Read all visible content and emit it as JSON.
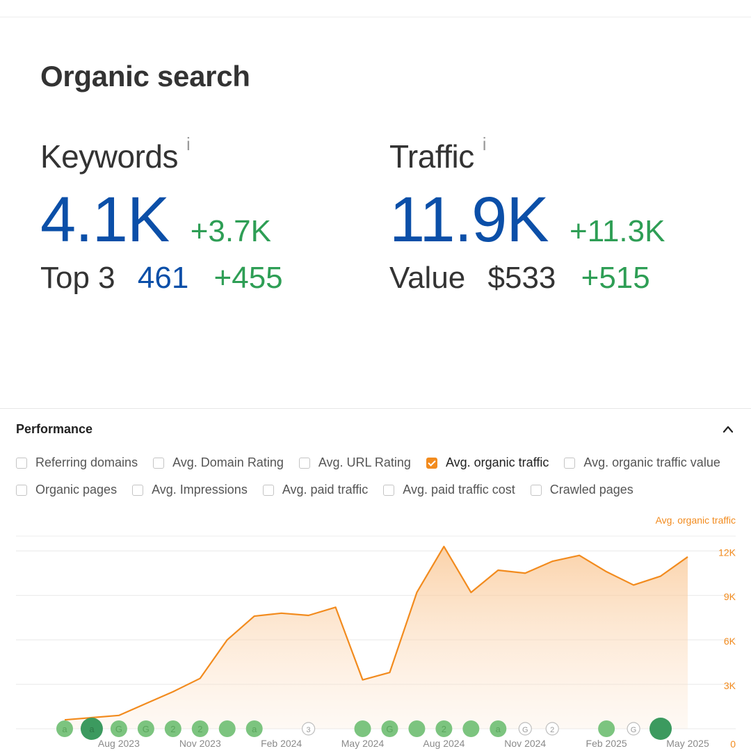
{
  "organic": {
    "title": "Organic search",
    "keywords": {
      "label": "Keywords",
      "info": "i",
      "value": "4.1K",
      "delta": "+3.7K",
      "sub_label": "Top 3",
      "sub_value": "461",
      "sub_delta": "+455"
    },
    "traffic": {
      "label": "Traffic",
      "info": "i",
      "value": "11.9K",
      "delta": "+11.3K",
      "sub_label": "Value",
      "sub_value": "$533",
      "sub_delta": "+515"
    }
  },
  "performance": {
    "title": "Performance",
    "collapse_icon": "chevron-up-icon",
    "checkboxes": [
      {
        "label": "Referring domains",
        "checked": false
      },
      {
        "label": "Avg. Domain Rating",
        "checked": false
      },
      {
        "label": "Avg. URL Rating",
        "checked": false
      },
      {
        "label": "Avg. organic traffic",
        "checked": true
      },
      {
        "label": "Avg. organic traffic value",
        "checked": false
      },
      {
        "label": "Organic pages",
        "checked": false
      },
      {
        "label": "Avg. Impressions",
        "checked": false
      },
      {
        "label": "Avg. paid traffic",
        "checked": false
      },
      {
        "label": "Avg. paid traffic cost",
        "checked": false
      },
      {
        "label": "Crawled pages",
        "checked": false
      }
    ]
  },
  "colors": {
    "accent": "#f28b1e",
    "value_blue": "#0b4fa8",
    "delta_green": "#2e9e55",
    "marker_green": "#7cc47f",
    "marker_dark": "#3c9a5f"
  },
  "chart_data": {
    "type": "area",
    "series": [
      {
        "name": "Avg. organic traffic",
        "color": "#f28b1e"
      }
    ],
    "ylim": [
      0,
      13000
    ],
    "yticks": [
      {
        "v": 0,
        "label": "0"
      },
      {
        "v": 3000,
        "label": "3K"
      },
      {
        "v": 6000,
        "label": "6K"
      },
      {
        "v": 9000,
        "label": "9K"
      },
      {
        "v": 12000,
        "label": "12K"
      }
    ],
    "xlim": [
      0,
      24
    ],
    "xticks": [
      {
        "x": 2,
        "label": "Aug 2023"
      },
      {
        "x": 5,
        "label": "Nov 2023"
      },
      {
        "x": 8,
        "label": "Feb 2024"
      },
      {
        "x": 11,
        "label": "May 2024"
      },
      {
        "x": 14,
        "label": "Aug 2024"
      },
      {
        "x": 17,
        "label": "Nov 2024"
      },
      {
        "x": 20,
        "label": "Feb 2025"
      },
      {
        "x": 23,
        "label": "May 2025"
      }
    ],
    "points": [
      [
        0,
        600
      ],
      [
        1,
        750
      ],
      [
        2,
        900
      ],
      [
        3,
        1700
      ],
      [
        4,
        2500
      ],
      [
        5,
        3400
      ],
      [
        6,
        6000
      ],
      [
        7,
        7600
      ],
      [
        8,
        7800
      ],
      [
        9,
        7650
      ],
      [
        10,
        8200
      ],
      [
        11,
        3300
      ],
      [
        12,
        3800
      ],
      [
        13,
        9200
      ],
      [
        14,
        12300
      ],
      [
        15,
        9200
      ],
      [
        16,
        10700
      ],
      [
        17,
        10500
      ],
      [
        18,
        11300
      ],
      [
        19,
        11700
      ],
      [
        20,
        10600
      ],
      [
        21,
        9700
      ],
      [
        22,
        10300
      ],
      [
        23,
        11600
      ]
    ],
    "markers": [
      {
        "x": 0,
        "kind": "filled",
        "size": "s",
        "label": "a"
      },
      {
        "x": 1,
        "kind": "dark",
        "size": "l",
        "label": "a"
      },
      {
        "x": 2,
        "kind": "filled",
        "size": "s",
        "label": "G"
      },
      {
        "x": 3,
        "kind": "filled",
        "size": "s",
        "label": "G"
      },
      {
        "x": 4,
        "kind": "filled",
        "size": "s",
        "label": "2"
      },
      {
        "x": 5,
        "kind": "filled",
        "size": "s",
        "label": "2"
      },
      {
        "x": 6,
        "kind": "filled",
        "size": "s",
        "label": ""
      },
      {
        "x": 7,
        "kind": "filled",
        "size": "s",
        "label": "a"
      },
      {
        "x": 9,
        "kind": "outline",
        "size": "s",
        "label": "3"
      },
      {
        "x": 11,
        "kind": "filled",
        "size": "s",
        "label": ""
      },
      {
        "x": 12,
        "kind": "filled",
        "size": "s",
        "label": "G"
      },
      {
        "x": 13,
        "kind": "filled",
        "size": "s",
        "label": ""
      },
      {
        "x": 14,
        "kind": "filled",
        "size": "s",
        "label": "2"
      },
      {
        "x": 15,
        "kind": "filled",
        "size": "s",
        "label": ""
      },
      {
        "x": 16,
        "kind": "filled",
        "size": "s",
        "label": "a"
      },
      {
        "x": 17,
        "kind": "outline",
        "size": "s",
        "label": "G"
      },
      {
        "x": 18,
        "kind": "outline",
        "size": "s",
        "label": "2"
      },
      {
        "x": 20,
        "kind": "filled",
        "size": "s",
        "label": ""
      },
      {
        "x": 21,
        "kind": "outline",
        "size": "s",
        "label": "G"
      },
      {
        "x": 22,
        "kind": "dark",
        "size": "l",
        "label": ""
      }
    ]
  }
}
